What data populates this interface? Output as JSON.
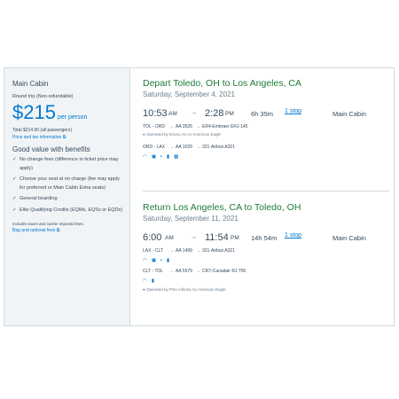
{
  "fare": {
    "cabin": "Main Cabin",
    "trip_type": "Round trip (Non-refundable)",
    "price": "$215",
    "per_person": "per person",
    "total": "Total $214.90 (all passengers)",
    "price_info_link": "Price and tax information",
    "benefits_title": "Good value with benefits",
    "benefits": [
      "No change fees (difference in ticket price may apply)",
      "Choose your seat at no charge (fee may apply for preferred or Main Cabin Extra seats)",
      "General boarding",
      "Elite Qualifying Credits (EQMs, EQSs or EQDs)"
    ],
    "fees_note": "Includes taxes and carrier imposed fees.",
    "bag_link": "Bag and optional fees"
  },
  "depart": {
    "keyword": "Depart",
    "route": "Toledo, OH to Los Angeles, CA",
    "date": "Saturday, September 4, 2021",
    "dep_time": "10:53",
    "dep_ampm": "AM",
    "arr_time": "2:28",
    "arr_ampm": "PM",
    "duration": "6h 35m",
    "stops": "1 stop",
    "cabin": "Main Cabin",
    "legs": [
      {
        "route": "TOL - ORD",
        "flight": "AA 3525",
        "aircraft": "ER4-Embraer ERJ-145",
        "operated": "Operated by Envoy Air As American Eagle"
      },
      {
        "route": "ORD - LAX",
        "flight": "AA 1029",
        "aircraft": "321-Airbus A321",
        "operated": ""
      }
    ]
  },
  "return": {
    "keyword": "Return",
    "route": "Los Angeles, CA to Toledo, OH",
    "date": "Saturday, September 11, 2021",
    "dep_time": "6:00",
    "dep_ampm": "AM",
    "arr_time": "11:54",
    "arr_ampm": "PM",
    "duration": "14h 54m",
    "stops": "1 stop",
    "cabin": "Main Cabin",
    "legs": [
      {
        "route": "LAX - CLT",
        "flight": "AA 1499",
        "aircraft": "321-Airbus A321",
        "operated": ""
      },
      {
        "route": "CLT - TOL",
        "flight": "AA 5579",
        "aircraft": "CR7-Canadair RJ 700",
        "operated": "Operated by PSA Airlines As American Eagle"
      }
    ]
  },
  "icons": {
    "wifi": "wifi-icon",
    "video": "entertainment-icon",
    "power": "power-icon",
    "app": "app-icon"
  },
  "colors": {
    "accent": "#0078d2",
    "depart_keyword": "#1f7a3a",
    "text": "#36495a",
    "panel_bg": "#f1f4f6"
  }
}
